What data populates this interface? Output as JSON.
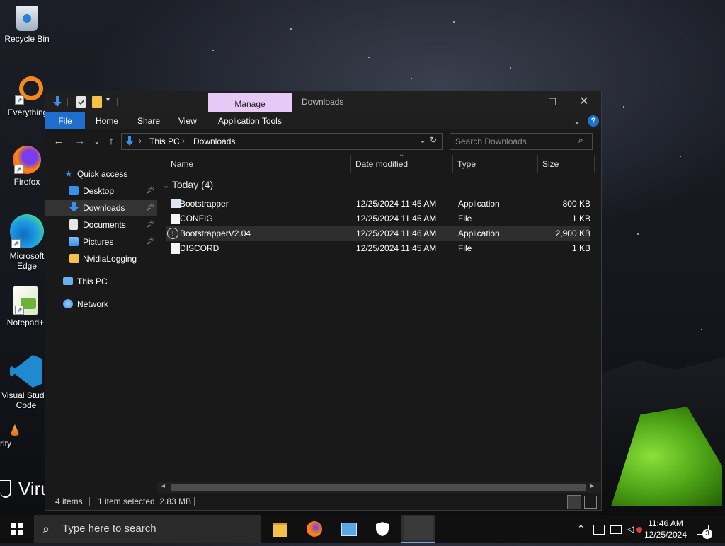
{
  "desktop": {
    "icons": [
      {
        "label": "Recycle Bin",
        "icon": "recycle-bin-icon"
      },
      {
        "label": "Everything",
        "icon": "everything-search-icon"
      },
      {
        "label": "Firefox",
        "icon": "firefox-icon"
      },
      {
        "label": "Microsoft Edge",
        "icon": "edge-icon"
      },
      {
        "label": "Notepad+",
        "icon": "notepad-plus-icon"
      },
      {
        "label": "Visual Studio Code",
        "icon": "vscode-icon"
      },
      {
        "label": "rity",
        "icon": "security-icon"
      }
    ],
    "partial_text": "Viru"
  },
  "window": {
    "title": "Downloads",
    "manage_tab": "Manage",
    "ribbon_tabs": [
      "File",
      "Home",
      "Share",
      "View",
      "Application Tools"
    ],
    "breadcrumb": [
      "This PC",
      "Downloads"
    ],
    "search_placeholder": "Search Downloads",
    "nav": {
      "quick_access": "Quick access",
      "items": [
        {
          "label": "Desktop",
          "pinned": true
        },
        {
          "label": "Downloads",
          "pinned": true,
          "selected": true
        },
        {
          "label": "Documents",
          "pinned": true
        },
        {
          "label": "Pictures",
          "pinned": true
        },
        {
          "label": "NvidiaLogging",
          "pinned": false
        }
      ],
      "this_pc": "This PC",
      "network": "Network"
    },
    "columns": [
      "Name",
      "Date modified",
      "Type",
      "Size"
    ],
    "group_label": "Today (4)",
    "files": [
      {
        "name": "Bootstrapper",
        "date": "12/25/2024 11:45 AM",
        "type": "Application",
        "size": "800 KB",
        "icon": "application-icon"
      },
      {
        "name": "CONFIG",
        "date": "12/25/2024 11:45 AM",
        "type": "File",
        "size": "1 KB",
        "icon": "file-icon"
      },
      {
        "name": "BootstrapperV2.04",
        "date": "12/25/2024 11:46 AM",
        "type": "Application",
        "size": "2,900 KB",
        "icon": "application-icon",
        "selected": true
      },
      {
        "name": "DISCORD",
        "date": "12/25/2024 11:45 AM",
        "type": "File",
        "size": "1 KB",
        "icon": "file-icon"
      }
    ],
    "status": {
      "items": "4 items",
      "selected": "1 item selected  2.83 MB"
    }
  },
  "taskbar": {
    "search_placeholder": "Type here to search",
    "time": "11:46 AM",
    "date": "12/25/2024",
    "notifications": "3"
  },
  "colors": {
    "accent": "#1f6fd1",
    "manage": "#e8c8f6",
    "window_bg": "#191919",
    "taskbar": "#101010"
  }
}
